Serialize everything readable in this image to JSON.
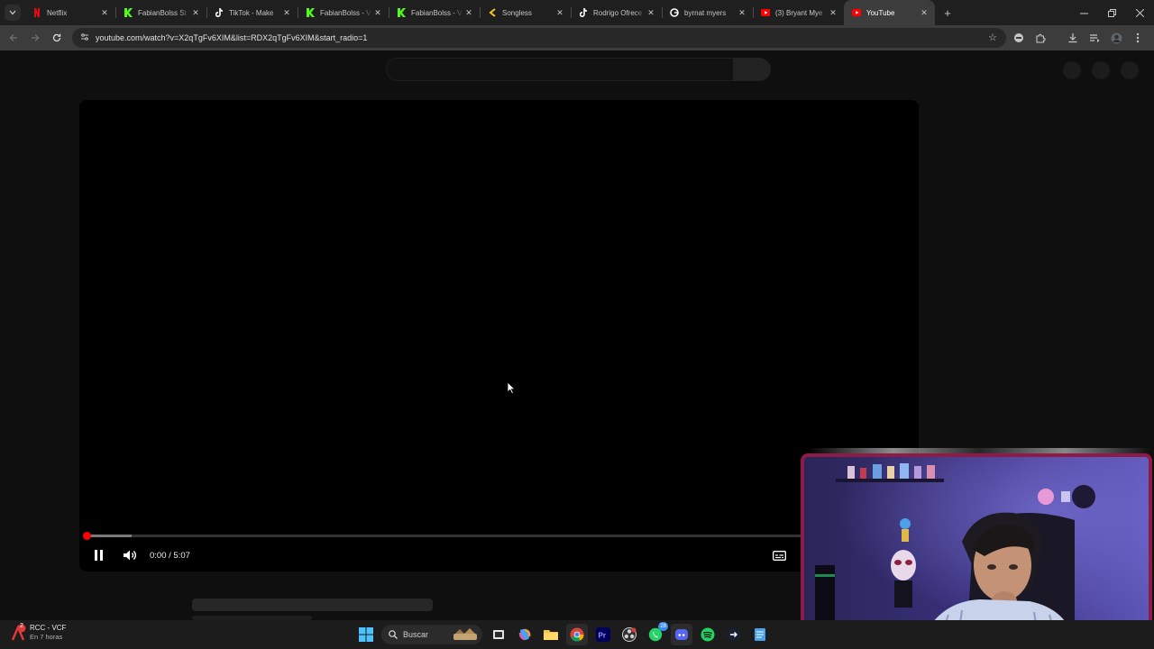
{
  "browser": {
    "tabs": [
      {
        "title": "Netflix",
        "favicon": "netflix-icon",
        "color": "#e50914",
        "active": false
      },
      {
        "title": "FabianBolss St",
        "favicon": "kick-icon",
        "color": "#53fc18",
        "active": false
      },
      {
        "title": "TikTok - Make",
        "favicon": "tiktok-icon",
        "color": "#ffffff",
        "active": false
      },
      {
        "title": "FabianBolss - V",
        "favicon": "kick-icon",
        "color": "#53fc18",
        "active": false
      },
      {
        "title": "FabianBolss - V",
        "favicon": "kick-icon",
        "color": "#53fc18",
        "active": false
      },
      {
        "title": "Songless",
        "favicon": "songless-icon",
        "color": "#f5c518",
        "active": false
      },
      {
        "title": "Rodrigo Ofrece",
        "favicon": "tiktok-icon",
        "color": "#ffffff",
        "active": false
      },
      {
        "title": "byrnat myers",
        "favicon": "google-icon",
        "color": "#ffffff",
        "active": false
      },
      {
        "title": "(3) Bryant Mye",
        "favicon": "youtube-icon",
        "color": "#ff0000",
        "active": false
      },
      {
        "title": "YouTube",
        "favicon": "youtube-icon",
        "color": "#ff0000",
        "active": true
      }
    ],
    "url": "youtube.com/watch?v=X2qTgFv6XIM&list=RDX2qTgFv6XIM&start_radio=1"
  },
  "player": {
    "time": "0:00 / 5:07",
    "progress_fraction": 0.0,
    "buffered_fraction": 0.055,
    "accent": "#ff0000",
    "state": "playing"
  },
  "taskbar": {
    "weather_title": "RCC - VCF",
    "weather_subtitle": "En 7 horas",
    "notification_count": "2",
    "search_placeholder": "Buscar",
    "whatsapp_badge": "28"
  }
}
